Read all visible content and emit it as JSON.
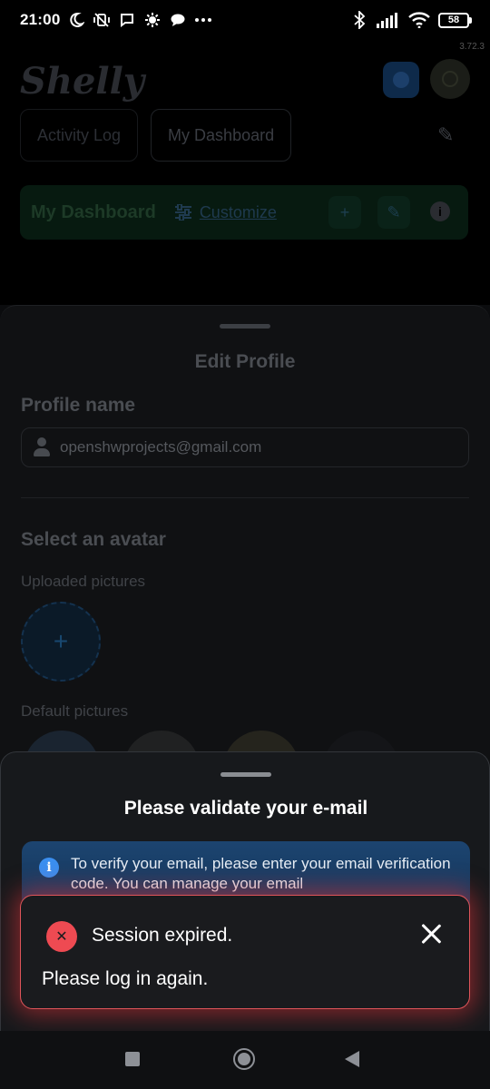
{
  "status_bar": {
    "time": "21:00",
    "battery": "58",
    "icons": [
      "moon-icon",
      "vibrate-off-icon",
      "chat-icon",
      "settings-cog-icon",
      "message-bubble-icon",
      "more-dots-icon",
      "bluetooth-icon",
      "signal-icon",
      "wifi-icon",
      "battery-icon"
    ]
  },
  "app": {
    "version": "3.72.3",
    "logo": "Shelly",
    "tabs": [
      {
        "label": "Activity Log",
        "active": false
      },
      {
        "label": "My Dashboard",
        "active": true
      }
    ],
    "dashboard": {
      "title": "My Dashboard",
      "customize_label": "Customize"
    }
  },
  "profile_sheet": {
    "title": "Edit Profile",
    "profile_name_label": "Profile name",
    "profile_name_value": "openshwprojects@gmail.com",
    "select_avatar_label": "Select an avatar",
    "uploaded_pictures_label": "Uploaded pictures",
    "default_pictures_label": "Default pictures"
  },
  "validate_sheet": {
    "title": "Please validate your e-mail",
    "info_text": "To verify your email, please enter your email verification code. You can manage your email"
  },
  "toast": {
    "title": "Session expired.",
    "message": "Please log in again."
  },
  "colors": {
    "toast_border": "#e0555a",
    "toast_icon": "#ee4a52",
    "info_box": "#1c4470",
    "info_icon": "#3b8ff0"
  }
}
